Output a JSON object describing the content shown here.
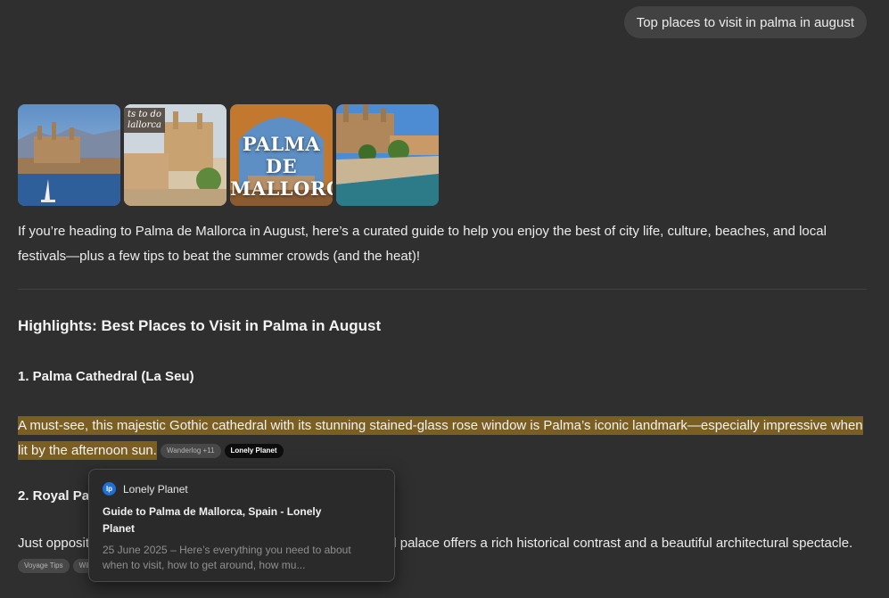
{
  "user_message": "Top places to visit in palma in august",
  "gallery": {
    "images": [
      {
        "icon": "palma-cathedral-bay-photo"
      },
      {
        "icon": "palma-cathedral-street-photo",
        "tag": "ts to do\nlallorca"
      },
      {
        "icon": "palma-de-mallorca-title-photo",
        "overlay": "PALMA DE\nMALLORCA"
      },
      {
        "icon": "palma-cathedral-park-photo"
      }
    ]
  },
  "intro": "If you’re heading to Palma de Mallorca in August, here’s a curated guide to help you enjoy the best of city life, culture, beaches, and local festivals—plus a few tips to beat the summer crowds (and the heat)!",
  "heading": "Highlights: Best Places to Visit in Palma in August",
  "section1": {
    "title": "1. Palma Cathedral (La Seu)",
    "text": "A must-see, this majestic Gothic cathedral with its stunning stained-glass rose window is Palma’s iconic landmark—especially impressive when lit by the afternoon sun.",
    "chips": [
      "Wanderlog +11",
      "Lonely Planet"
    ]
  },
  "section2": {
    "title_visible": "2. Royal Pa",
    "text_start": "Just opposit",
    "text_end": "royal palace offers a rich historical contrast and a beautiful architectural spectacle.",
    "chips": [
      "Voyage Tips",
      "Wik"
    ]
  },
  "popover": {
    "source_icon": "lonely-planet-icon",
    "source_icon_text": "lp",
    "source": "Lonely Planet",
    "title": "Guide to Palma de Mallorca, Spain - Lonely Planet",
    "description": "25 June 2025 – Here’s everything you need to about when to visit, how to get around, how mu..."
  },
  "colors": {
    "background": "#2f2f2f",
    "highlight": "#7b5e22",
    "user_bubble": "#424242",
    "lp_blue": "#1f6fd9"
  }
}
